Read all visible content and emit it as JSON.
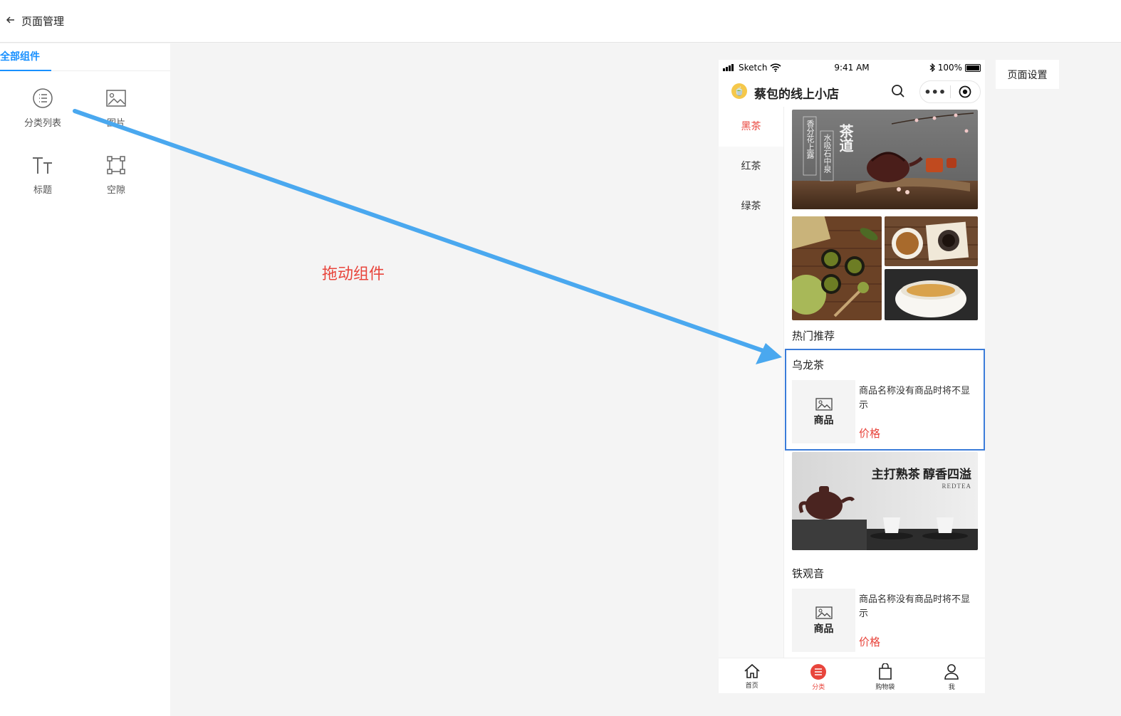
{
  "header": {
    "back_icon": "arrow-left-icon",
    "title": "页面管理"
  },
  "left_panel": {
    "tab_label": "全部组件",
    "components": [
      {
        "label": "分类列表",
        "icon": "list-icon"
      },
      {
        "label": "图片",
        "icon": "image-icon"
      },
      {
        "label": "标题",
        "icon": "text-icon"
      },
      {
        "label": "空隙",
        "icon": "spacing-icon"
      }
    ]
  },
  "canvas": {
    "drag_hint": "拖动组件"
  },
  "page_settings_label": "页面设置",
  "phone": {
    "status": {
      "carrier": "Sketch",
      "time": "9:41 AM",
      "battery": "100%"
    },
    "shop_name": "蔡包的线上小店",
    "categories": [
      {
        "label": "黑茶",
        "active": true
      },
      {
        "label": "红茶",
        "active": false
      },
      {
        "label": "绿茶",
        "active": false
      }
    ],
    "banner_text": {
      "vertical_1": "香分花上露",
      "vertical_2": "水吸石中泉",
      "calligraphy": "茶道"
    },
    "hot_title": "热门推荐",
    "selected_section": {
      "title": "乌龙茶",
      "product": {
        "placeholder": "商品",
        "name": "商品名称没有商品时将不显示",
        "price": "价格"
      }
    },
    "banner2": {
      "title": "主打熟茶 醇香四溢",
      "subtitle": "REDTEA"
    },
    "section2": {
      "title": "铁观音",
      "product": {
        "placeholder": "商品",
        "name": "商品名称没有商品时将不显示",
        "price": "价格"
      }
    },
    "tabbar": [
      {
        "label": "首页",
        "icon": "home-icon",
        "active": false
      },
      {
        "label": "分类",
        "icon": "category-icon",
        "active": true
      },
      {
        "label": "购物袋",
        "icon": "bag-icon",
        "active": false
      },
      {
        "label": "我",
        "icon": "user-icon",
        "active": false
      }
    ]
  },
  "colors": {
    "accent": "#1890ff",
    "brand_red": "#e8453c",
    "selection": "#3b7cd9",
    "arrow": "#4aa8ef"
  }
}
